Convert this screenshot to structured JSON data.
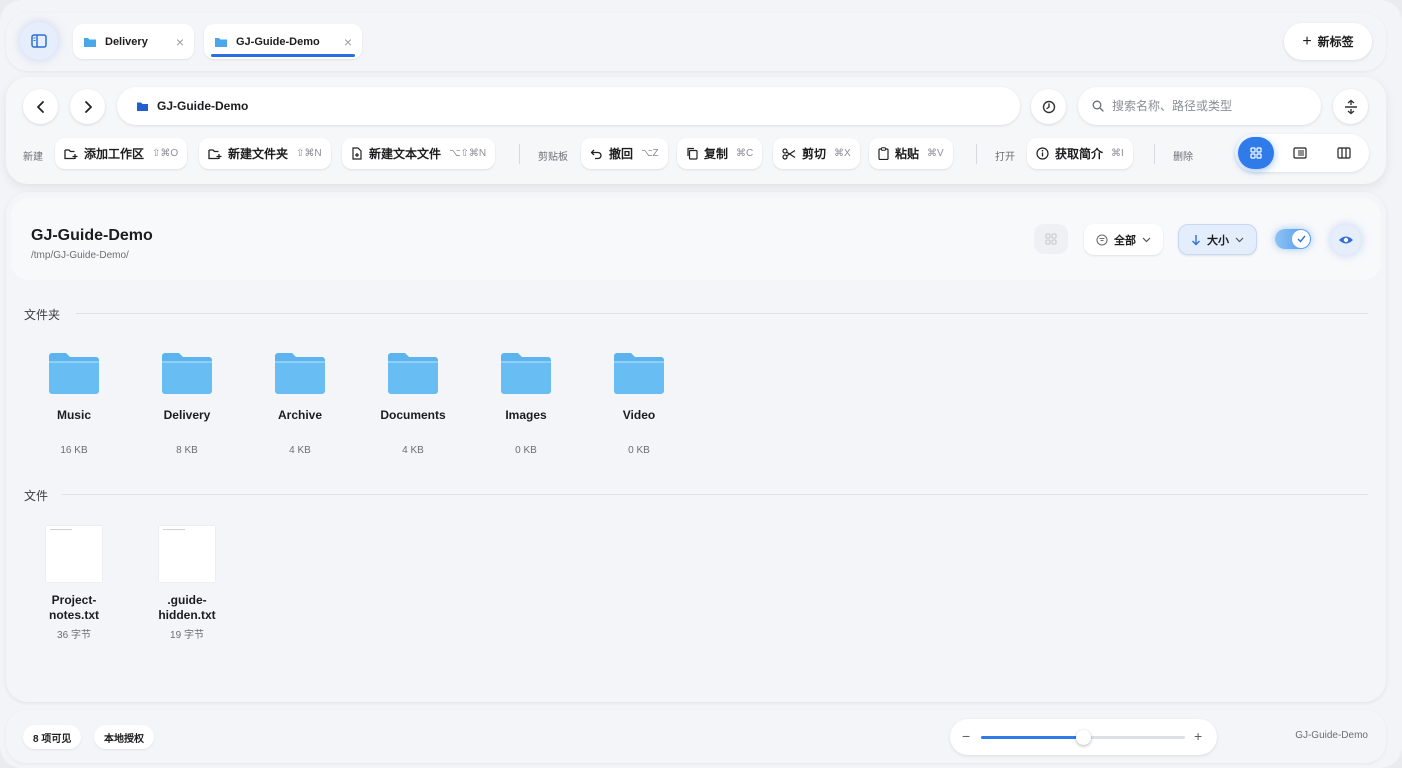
{
  "tabs": [
    {
      "label": "Delivery",
      "active": false
    },
    {
      "label": "GJ-Guide-Demo",
      "active": true
    }
  ],
  "new_tab_label": "新标签",
  "address": {
    "path": "GJ-Guide-Demo"
  },
  "search": {
    "placeholder": "搜索名称、路径或类型"
  },
  "toolbar": {
    "group_new": "新建",
    "add_workspace": {
      "label": "添加工作区",
      "shortcut": "⇧⌘O"
    },
    "new_folder": {
      "label": "新建文件夹",
      "shortcut": "⇧⌘N"
    },
    "new_text_file": {
      "label": "新建文本文件",
      "shortcut": "⌥⇧⌘N"
    },
    "group_clipboard": "剪贴板",
    "undo": {
      "label": "撤回",
      "shortcut": "⌥Z"
    },
    "copy": {
      "label": "复制",
      "shortcut": "⌘C"
    },
    "cut": {
      "label": "剪切",
      "shortcut": "⌘X"
    },
    "paste": {
      "label": "粘贴",
      "shortcut": "⌘V"
    },
    "group_open": "打开",
    "get_info": {
      "label": "获取简介",
      "shortcut": "⌘I"
    },
    "group_delete": "删除"
  },
  "main": {
    "title": "GJ-Guide-Demo",
    "path": "/tmp/GJ-Guide-Demo/",
    "filter_label": "全部",
    "sort_label": "大小",
    "folders_section": "文件夹",
    "files_section": "文件",
    "folders": [
      {
        "name": "Music",
        "size": "16 KB"
      },
      {
        "name": "Delivery",
        "size": "8 KB"
      },
      {
        "name": "Archive",
        "size": "4 KB"
      },
      {
        "name": "Documents",
        "size": "4 KB"
      },
      {
        "name": "Images",
        "size": "0 KB"
      },
      {
        "name": "Video",
        "size": "0 KB"
      }
    ],
    "files": [
      {
        "name_line1": "Project-",
        "name_line2": "notes.txt",
        "size": "36 字节"
      },
      {
        "name_line1": ".guide-",
        "name_line2": "hidden.txt",
        "size": "19 字节"
      }
    ]
  },
  "status": {
    "visible_count": "8 项可见",
    "local_auth": "本地授权",
    "zoom_level": 0.5,
    "location": "GJ-Guide-Demo"
  },
  "colors": {
    "accent": "#2f7bea",
    "folder_top": "#5cb3ee",
    "folder_body": "#68bdf2"
  }
}
